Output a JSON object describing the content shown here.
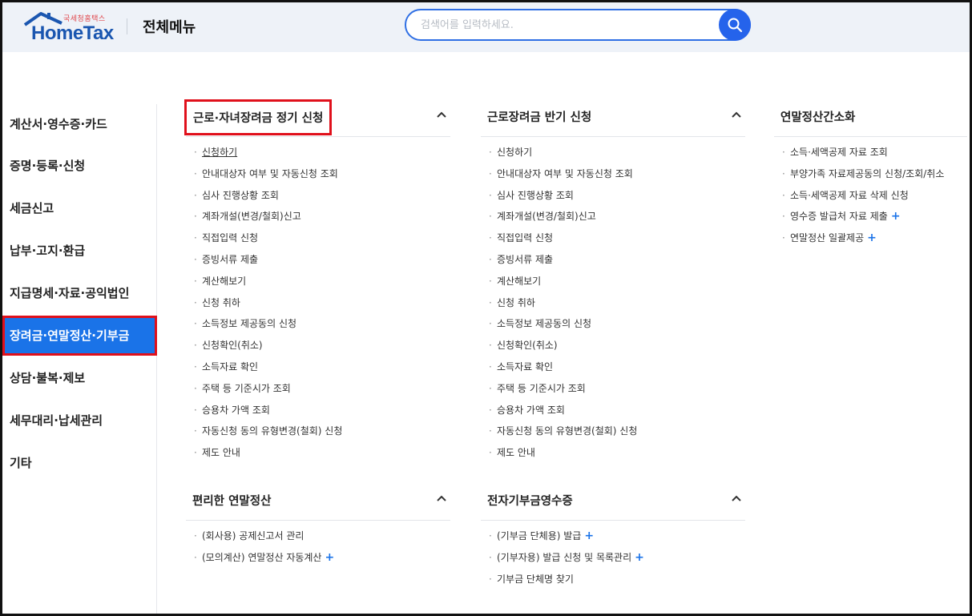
{
  "header": {
    "logo_small": "국세청홈택스",
    "logo_main": "HomeTax",
    "menu_title": "전체메뉴",
    "search_placeholder": "검색어를 입력하세요."
  },
  "nav": {
    "items": [
      {
        "label": "계산서·영수증·카드",
        "active": false
      },
      {
        "label": "증명·등록·신청",
        "active": false
      },
      {
        "label": "세금신고",
        "active": false
      },
      {
        "label": "납부·고지·환급",
        "active": false
      },
      {
        "label": "지급명세·자료·공익법인",
        "active": false
      },
      {
        "label": "장려금·연말정산·기부금",
        "active": true
      },
      {
        "label": "상담·불복·제보",
        "active": false
      },
      {
        "label": "세무대리·납세관리",
        "active": false
      },
      {
        "label": "기타",
        "active": false
      }
    ]
  },
  "sections": {
    "s1": {
      "title": "근로·자녀장려금 정기 신청",
      "items": [
        {
          "label": "신청하기",
          "plus": ""
        },
        {
          "label": "안내대상자 여부 및 자동신청 조회",
          "plus": ""
        },
        {
          "label": "심사 진행상황 조회",
          "plus": ""
        },
        {
          "label": "계좌개설(변경/철회)신고",
          "plus": ""
        },
        {
          "label": "직접입력 신청",
          "plus": ""
        },
        {
          "label": "증빙서류 제출",
          "plus": ""
        },
        {
          "label": "계산해보기",
          "plus": ""
        },
        {
          "label": "신청 취하",
          "plus": ""
        },
        {
          "label": "소득정보 제공동의 신청",
          "plus": ""
        },
        {
          "label": "신청확인(취소)",
          "plus": ""
        },
        {
          "label": "소득자료 확인",
          "plus": ""
        },
        {
          "label": "주택 등 기준시가 조회",
          "plus": ""
        },
        {
          "label": "승용차 가액 조회",
          "plus": ""
        },
        {
          "label": "자동신청 동의 유형변경(철회) 신청",
          "plus": ""
        },
        {
          "label": "제도 안내",
          "plus": ""
        }
      ]
    },
    "s2": {
      "title": "근로장려금 반기 신청",
      "items": [
        {
          "label": "신청하기",
          "plus": ""
        },
        {
          "label": "안내대상자 여부 및 자동신청 조회",
          "plus": ""
        },
        {
          "label": "심사 진행상황 조회",
          "plus": ""
        },
        {
          "label": "계좌개설(변경/철회)신고",
          "plus": ""
        },
        {
          "label": "직접입력 신청",
          "plus": ""
        },
        {
          "label": "증빙서류 제출",
          "plus": ""
        },
        {
          "label": "계산해보기",
          "plus": ""
        },
        {
          "label": "신청 취하",
          "plus": ""
        },
        {
          "label": "소득정보 제공동의 신청",
          "plus": ""
        },
        {
          "label": "신청확인(취소)",
          "plus": ""
        },
        {
          "label": "소득자료 확인",
          "plus": ""
        },
        {
          "label": "주택 등 기준시가 조회",
          "plus": ""
        },
        {
          "label": "승용차 가액 조회",
          "plus": ""
        },
        {
          "label": "자동신청 동의 유형변경(철회) 신청",
          "plus": ""
        },
        {
          "label": "제도 안내",
          "plus": ""
        }
      ]
    },
    "s3": {
      "title": "연말정산간소화",
      "items": [
        {
          "label": "소득·세액공제 자료 조회",
          "plus": ""
        },
        {
          "label": "부양가족 자료제공동의 신청/조회/취소",
          "plus": ""
        },
        {
          "label": "소득·세액공제 자료 삭제 신청",
          "plus": ""
        },
        {
          "label": "영수증 발급처 자료 제출",
          "plus": "+"
        },
        {
          "label": "연말정산 일괄제공",
          "plus": "+"
        }
      ]
    },
    "s4": {
      "title": "편리한 연말정산",
      "items": [
        {
          "label": "(회사용) 공제신고서 관리",
          "plus": ""
        },
        {
          "label": "(모의계산) 연말정산 자동계산",
          "plus": "+"
        }
      ]
    },
    "s5": {
      "title": "전자기부금영수증",
      "items": [
        {
          "label": "(기부금 단체용) 발급",
          "plus": "+"
        },
        {
          "label": "(기부자용) 발급 신청 및 목록관리",
          "plus": "+"
        },
        {
          "label": "기부금 단체명 찾기",
          "plus": ""
        }
      ]
    }
  },
  "colors": {
    "accent": "#1a73e8",
    "highlight_border": "#e0101b",
    "header_bg": "#eef2f8",
    "search_button": "#2563eb"
  },
  "icons": {
    "search": "search-icon",
    "collapse": "chevron-up-icon",
    "logo_roof": "house-roof-icon"
  }
}
